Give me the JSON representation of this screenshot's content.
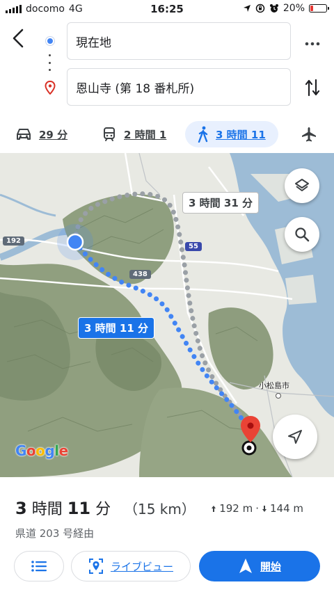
{
  "status_bar": {
    "carrier": "docomo",
    "network": "4G",
    "time": "16:25",
    "battery": "20%",
    "battery_level": 0.2,
    "icons": [
      "location-arrow-icon",
      "screen-rotation-lock-icon",
      "alarm-icon"
    ]
  },
  "header": {
    "back_icon": "back-arrow-icon",
    "origin": "現在地",
    "destination": "恩山寺 (第 18 番札所)",
    "more_icon": "more-options-icon",
    "swap_icon": "swap-direction-icon"
  },
  "modes": [
    {
      "icon": "car-icon",
      "label": "29 分",
      "active": false
    },
    {
      "icon": "train-icon",
      "label": "2 時間 1",
      "active": false
    },
    {
      "icon": "walking-icon",
      "label": "3 時間 11",
      "active": true
    },
    {
      "icon": "flight-icon",
      "label": "",
      "active": false
    }
  ],
  "map": {
    "alt_route_label": "3 時間 31 分",
    "main_route_label": "3 時間 11 分",
    "road_labels": [
      "192",
      "55",
      "438"
    ],
    "place_label": "小松島市",
    "brand": "Google",
    "layers_icon": "layers-icon",
    "search_icon": "search-icon",
    "navigate_icon": "navigation-arrow-icon"
  },
  "summary": {
    "duration_num1": "3",
    "duration_unit1": "時間",
    "duration_num2": "11",
    "duration_unit2": "分",
    "distance": "（15 km）",
    "ascent": "192 m",
    "descent": "144 m",
    "separator": "·",
    "via": "県道 203 号経由"
  },
  "actions": {
    "steps_icon": "list-icon",
    "live_view_label": "ライブビュー",
    "start_label": "開始"
  },
  "colors": {
    "accent": "#1a73e8",
    "route": "#4285f4",
    "alt_route": "#9aa0a6",
    "destination_pin": "#ea4335",
    "water": "#9dbcd6",
    "battery_low": "#e53935"
  }
}
